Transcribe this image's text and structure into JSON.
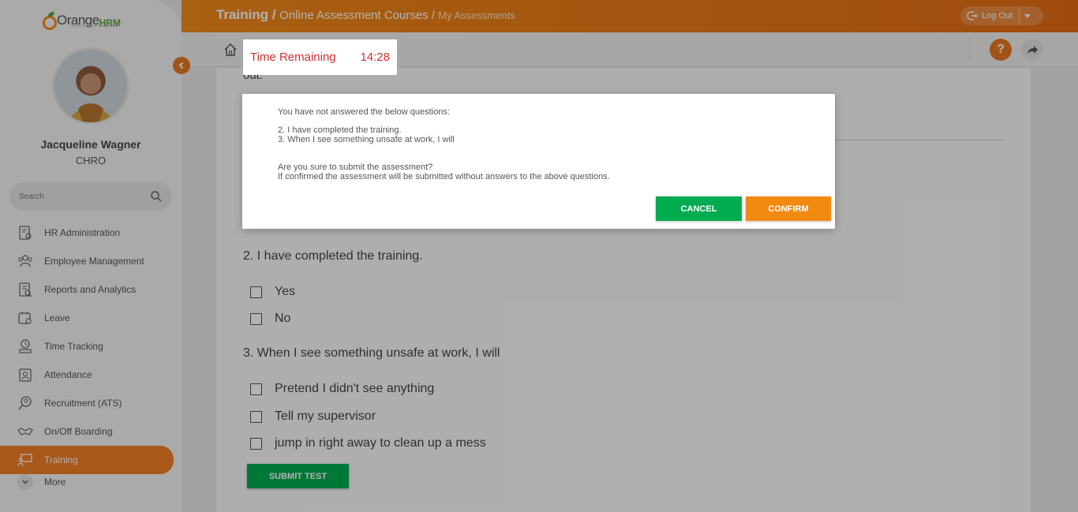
{
  "brand": {
    "name": "Orange",
    "suffix": "HRM",
    "tagline": "WORK-LEVEL HR MANAGEMENT"
  },
  "user": {
    "name": "Jacqueline Wagner",
    "role": "CHRO"
  },
  "search": {
    "placeholder": "Search"
  },
  "sidebar": {
    "items": [
      {
        "label": "HR Administration",
        "icon": "hr-admin-icon"
      },
      {
        "label": "Employee Management",
        "icon": "employee-management-icon"
      },
      {
        "label": "Reports and Analytics",
        "icon": "reports-icon"
      },
      {
        "label": "Leave",
        "icon": "leave-icon"
      },
      {
        "label": "Time Tracking",
        "icon": "time-tracking-icon"
      },
      {
        "label": "Attendance",
        "icon": "attendance-icon"
      },
      {
        "label": "Recruitment (ATS)",
        "icon": "recruitment-icon"
      },
      {
        "label": "On/Off Boarding",
        "icon": "boarding-icon"
      },
      {
        "label": "Training",
        "icon": "training-icon",
        "active": true
      }
    ],
    "more_label": "More"
  },
  "header": {
    "crumb1": "Training",
    "sep1": " / ",
    "crumb2": "Online Assessment Courses",
    "sep2": " / ",
    "crumb3": "My Assessments",
    "logout_label": "Log Out"
  },
  "content": {
    "cut_text": "out.",
    "q2": {
      "text": "2. I have completed the training.",
      "options": [
        "Yes",
        "No"
      ]
    },
    "q3": {
      "text": "3. When I see something unsafe at work, I will",
      "options": [
        "Pretend I didn't see anything",
        "Tell my supervisor",
        "jump in right away to clean up a mess"
      ]
    },
    "submit_label": "SUBMIT TEST"
  },
  "timer": {
    "label": "Time Remaining",
    "value": "14:28"
  },
  "dialog": {
    "intro": "You have not answered the below questions:",
    "unanswered": [
      "2. I have completed the training.",
      "3. When I see something unsafe at work, I will"
    ],
    "confirm_question": "Are you sure to submit the assessment?",
    "confirm_note": "If confirmed the assessment will be submitted without answers to the above questions.",
    "cancel_label": "CANCEL",
    "confirm_label": "CONFIRM"
  },
  "colors": {
    "accent": "#f28a12",
    "green": "#00ac4f",
    "timer_red": "#d32f2f"
  }
}
